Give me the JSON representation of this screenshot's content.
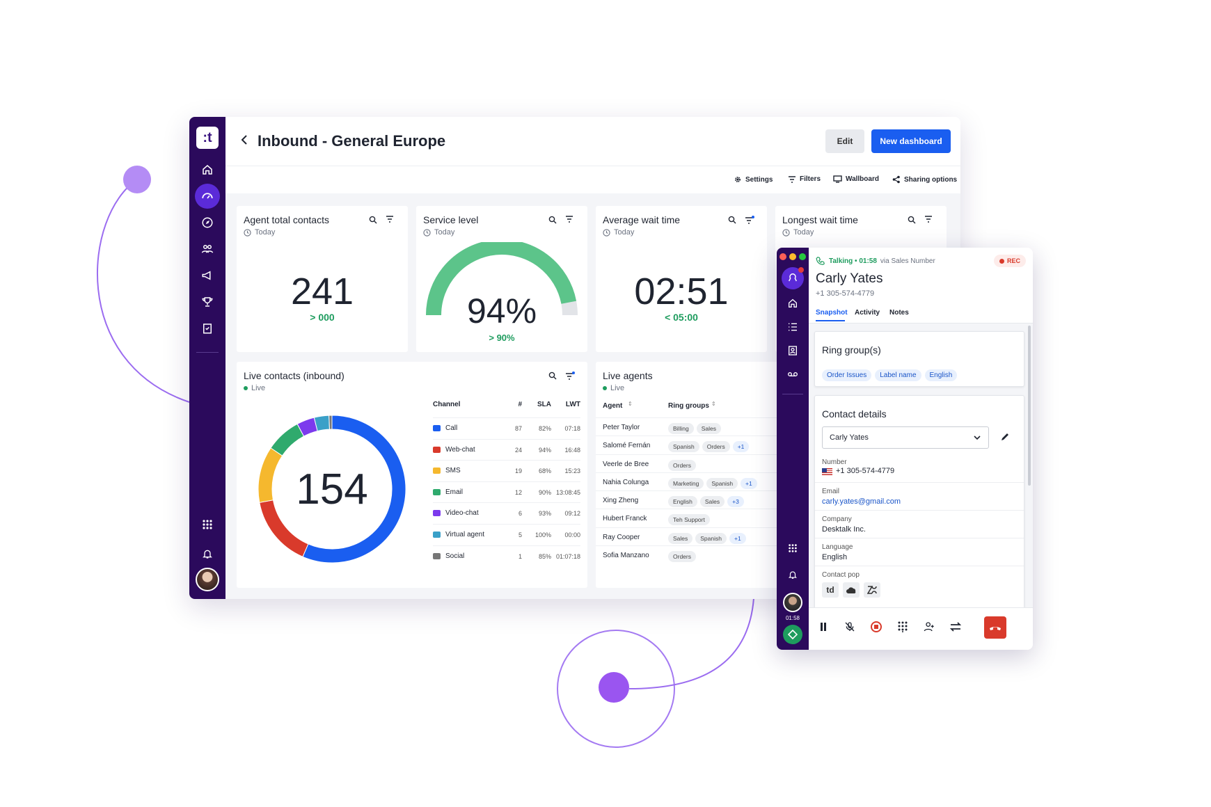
{
  "app": {
    "logo_text": "t"
  },
  "header": {
    "title": "Inbound - General Europe",
    "edit_label": "Edit",
    "new_label": "New dashboard"
  },
  "toolbar": {
    "settings": "Settings",
    "filters": "Filters",
    "wallboard": "Wallboard",
    "sharing": "Sharing options"
  },
  "cards": {
    "agent_total": {
      "title": "Agent total contacts",
      "period": "Today",
      "value": "241",
      "target": "> 000"
    },
    "service_level": {
      "title": "Service level",
      "period": "Today",
      "value": "94%",
      "target": "> 90%",
      "percent": 94
    },
    "avg_wait": {
      "title": "Average wait time",
      "period": "Today",
      "value": "02:51",
      "target": "< 05:00"
    },
    "longest_wait": {
      "title": "Longest wait time",
      "period": "Today"
    }
  },
  "live_contacts": {
    "title": "Live contacts (inbound)",
    "status": "Live",
    "total": "154",
    "columns": [
      "Channel",
      "#",
      "SLA",
      "LWT"
    ],
    "rows": [
      {
        "channel": "Call",
        "count": "87",
        "sla": "82%",
        "lwt": "07:18",
        "icon": "phone-icon",
        "color": "#1a5ef0"
      },
      {
        "channel": "Web-chat",
        "count": "24",
        "sla": "94%",
        "lwt": "16:48",
        "icon": "chat-icon",
        "color": "#d93a2b"
      },
      {
        "channel": "SMS",
        "count": "19",
        "sla": "68%",
        "lwt": "15:23",
        "icon": "sms-icon",
        "color": "#f5b82e"
      },
      {
        "channel": "Email",
        "count": "12",
        "sla": "90%",
        "lwt": "13:08:45",
        "icon": "email-icon",
        "color": "#2faa6d"
      },
      {
        "channel": "Video-chat",
        "count": "6",
        "sla": "93%",
        "lwt": "09:12",
        "icon": "video-icon",
        "color": "#7c3aed"
      },
      {
        "channel": "Virtual agent",
        "count": "5",
        "sla": "100%",
        "lwt": "00:00",
        "icon": "bot-icon",
        "color": "#3aa0c8"
      },
      {
        "channel": "Social",
        "count": "1",
        "sla": "85%",
        "lwt": "01:07:18",
        "icon": "social-icon",
        "color": "#777777"
      }
    ]
  },
  "live_agents": {
    "title": "Live agents",
    "status": "Live",
    "columns": [
      "Agent",
      "Ring groups"
    ],
    "rows": [
      {
        "name": "Peter Taylor",
        "groups": [
          "Billing",
          "Sales"
        ]
      },
      {
        "name": "Salomé Fernán",
        "groups": [
          "Spanish",
          "Orders",
          "+1"
        ]
      },
      {
        "name": "Veerle de Bree",
        "groups": [
          "Orders"
        ]
      },
      {
        "name": "Nahia Colunga",
        "groups": [
          "Marketing",
          "Spanish",
          "+1"
        ]
      },
      {
        "name": "Xing Zheng",
        "groups": [
          "English",
          "Sales",
          "+3"
        ]
      },
      {
        "name": "Hubert Franck",
        "groups": [
          "Teh Support"
        ]
      },
      {
        "name": "Ray Cooper",
        "groups": [
          "Sales",
          "Spanish",
          "+1"
        ]
      },
      {
        "name": "Sofia Manzano",
        "groups": [
          "Orders"
        ]
      }
    ]
  },
  "call": {
    "status": "Talking • 01:58",
    "via": "via Sales Number",
    "rec": "REC",
    "name": "Carly Yates",
    "phone": "+1 305-574-4779",
    "tabs": [
      "Snapshot",
      "Activity",
      "Notes"
    ],
    "ring_groups_title": "Ring group(s)",
    "ring_groups": [
      "Order Issues",
      "Label name",
      "English"
    ],
    "contact_title": "Contact details",
    "contact_select": "Carly Yates",
    "number_label": "Number",
    "number": "+1 305-574-4779",
    "email_label": "Email",
    "email": "carly.yates@gmail.com",
    "company_label": "Company",
    "company": "Desktalk Inc.",
    "language_label": "Language",
    "language": "English",
    "pop_label": "Contact pop",
    "timer": "01:58"
  },
  "colors": {
    "brand": "#2b0a5c",
    "accent": "#1a5ef0",
    "good": "#1e9c5e",
    "gauge": "#5cc48a",
    "rec": "#d93a2b"
  }
}
